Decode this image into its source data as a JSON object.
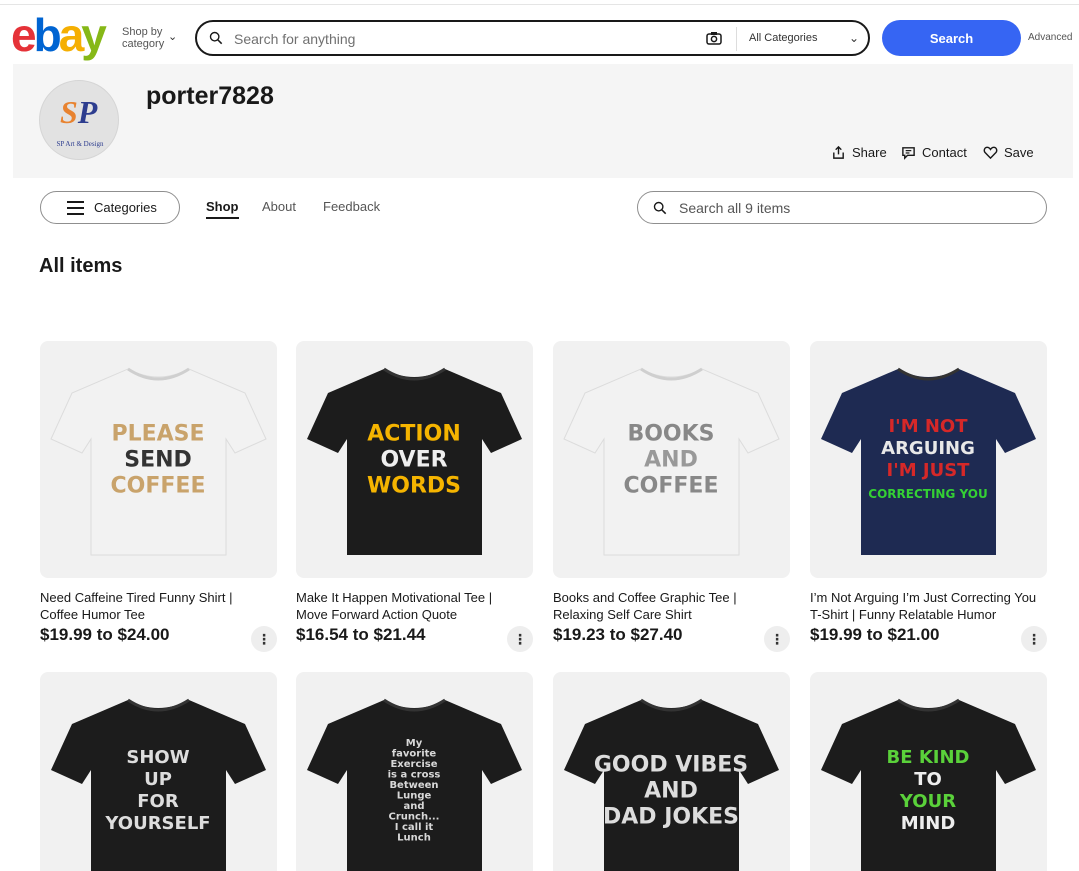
{
  "header": {
    "logo_letters": [
      "e",
      "b",
      "a",
      "y"
    ],
    "shop_by_line1": "Shop by",
    "shop_by_line2": "category",
    "search_placeholder": "Search for anything",
    "category_select": "All Categories",
    "search_button": "Search",
    "advanced_link": "Advanced"
  },
  "store": {
    "logo_text_s": "S",
    "logo_text_p": "P",
    "logo_caption": "SP Art & Design",
    "name": "porter7828",
    "share_label": "Share",
    "contact_label": "Contact",
    "save_label": "Save"
  },
  "nav": {
    "categories_label": "Categories",
    "tabs": [
      "Shop",
      "About",
      "Feedback"
    ],
    "active_tab": "Shop",
    "search_placeholder": "Search all 9 items"
  },
  "section_title": "All items",
  "items": [
    {
      "title": "Need Caffeine Tired Funny Shirt | Coffee Humor Tee",
      "price": "$19.99 to $24.00",
      "shirt_color": "#f2f2f2",
      "print_lines": [
        "PLEASE",
        "SEND",
        "COFFEE"
      ]
    },
    {
      "title": "Make It Happen Motivational Tee | Move Forward Action Quote",
      "price": "$16.54 to $21.44",
      "shirt_color": "#1c1c1c",
      "print_lines": [
        "ACTION",
        "OVER",
        "WORDS"
      ]
    },
    {
      "title": "Books and Coffee Graphic Tee | Relaxing Self Care Shirt",
      "price": "$19.23 to $27.40",
      "shirt_color": "#f2f2f2",
      "print_lines": [
        "BOOKS",
        "AND",
        "COFFEE"
      ]
    },
    {
      "title": "I’m Not Arguing I’m Just Correcting You T-Shirt | Funny Relatable Humor",
      "price": "$19.99 to $21.00",
      "shirt_color": "#1e2a52",
      "print_lines": [
        "I'M NOT",
        "ARGUING",
        "I'M JUST",
        "CORRECTING YOU"
      ]
    },
    {
      "title": "",
      "price": "",
      "shirt_color": "#1c1c1c",
      "print_lines": [
        "SHOW",
        "UP",
        "FOR",
        "YOURSELF"
      ]
    },
    {
      "title": "",
      "price": "",
      "shirt_color": "#1c1c1c",
      "print_lines": [
        "My",
        "favorite",
        "Exercise",
        "is a cross",
        "Between",
        "Lunge",
        "and",
        "Crunch...",
        "I call it",
        "Lunch"
      ]
    },
    {
      "title": "",
      "price": "",
      "shirt_color": "#1c1c1c",
      "print_lines": [
        "GOOD VIBES",
        "AND",
        "DAD JOKES"
      ]
    },
    {
      "title": "",
      "price": "",
      "shirt_color": "#1c1c1c",
      "print_lines": [
        "BE KIND",
        "TO",
        "YOUR",
        "MIND"
      ]
    }
  ],
  "more_icon": "⋮"
}
